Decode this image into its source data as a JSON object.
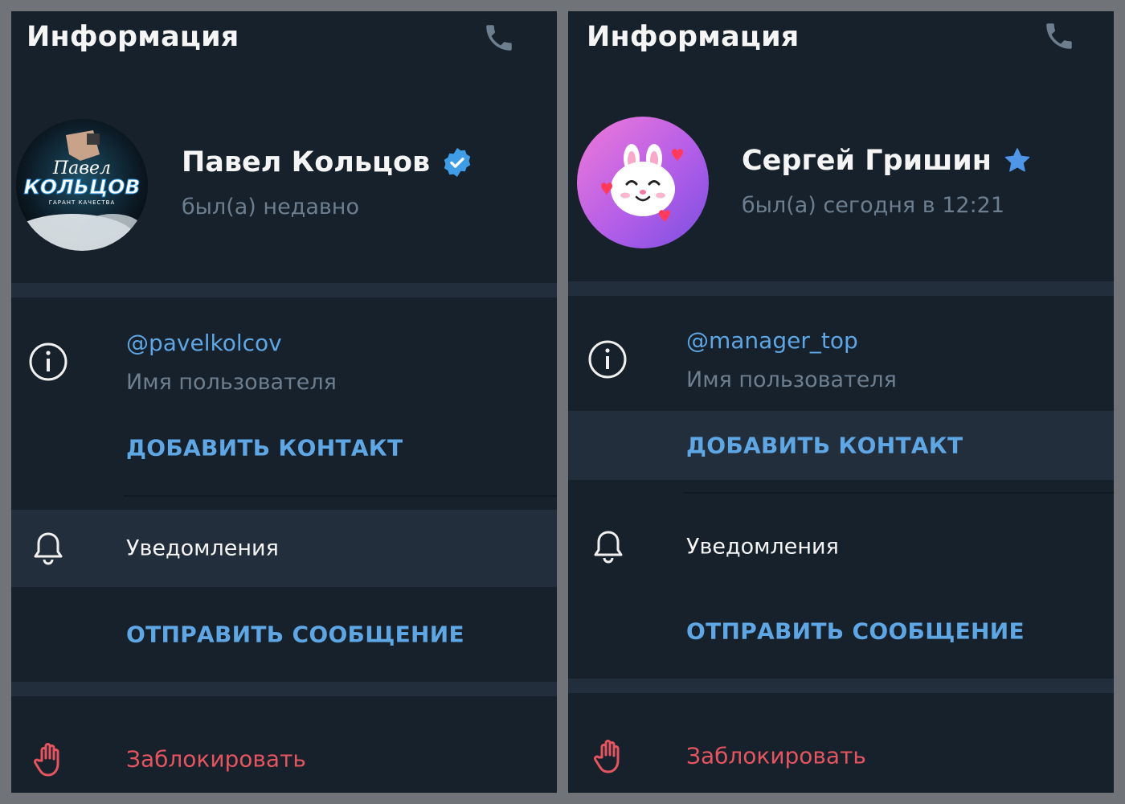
{
  "panels": [
    {
      "header": {
        "title": "Информация"
      },
      "profile": {
        "name": "Павел Кольцов",
        "status": "был(а) недавно",
        "badge": "verified-check-icon",
        "avatar_text": {
          "line1": "Павел",
          "line2": "КОЛЬЦОВ",
          "line3": "ГАРАНТ КАЧЕСТВА"
        }
      },
      "username": {
        "value": "@pavelkolcov",
        "label": "Имя пользователя"
      },
      "add_contact_label": "ДОБАВИТЬ КОНТАКТ",
      "notifications_label": "Уведомления",
      "send_message_label": "ОТПРАВИТЬ СООБЩЕНИЕ",
      "block_label": "Заблокировать"
    },
    {
      "header": {
        "title": "Информация"
      },
      "profile": {
        "name": "Сергей Гришин",
        "status": "был(а) сегодня в 12:21",
        "badge": "star-icon"
      },
      "username": {
        "value": "@manager_top",
        "label": "Имя пользователя"
      },
      "add_contact_label": "ДОБАВИТЬ КОНТАКТ",
      "notifications_label": "Уведомления",
      "send_message_label": "ОТПРАВИТЬ СООБЩЕНИЕ",
      "block_label": "Заблокировать"
    }
  ],
  "colors": {
    "panel_bg": "#17212b",
    "separator": "#232e3c",
    "accent_blue": "#5ea6e4",
    "muted": "#6d7f8f",
    "danger": "#e5555f",
    "text": "#f5f5f5"
  }
}
